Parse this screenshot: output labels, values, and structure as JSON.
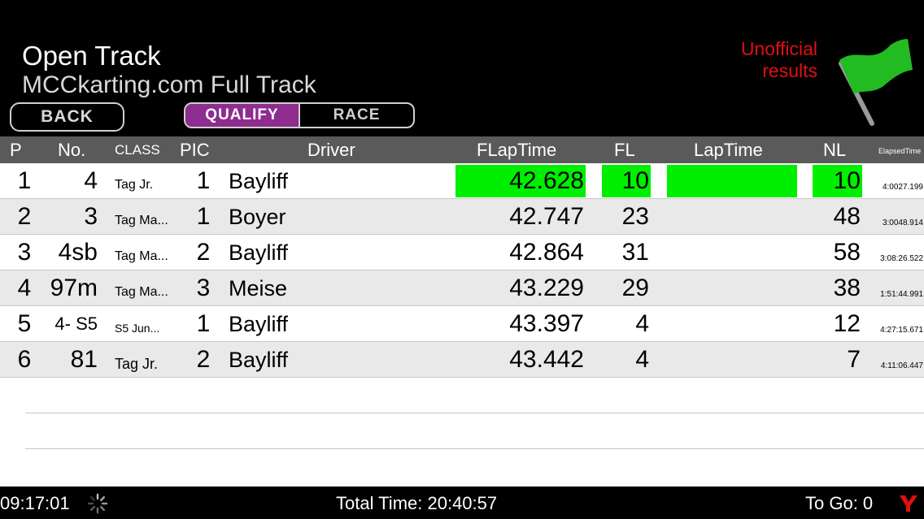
{
  "header": {
    "title": "Open Track",
    "subtitle": "MCCkarting.com Full Track",
    "back_label": "BACK",
    "tabs": [
      {
        "label": "QUALIFY",
        "active": true
      },
      {
        "label": "RACE",
        "active": false
      }
    ],
    "notice_line1": "Unofficial",
    "notice_line2": "results",
    "flag_color": "#22bb22"
  },
  "table": {
    "columns": {
      "p": "P",
      "no": "No.",
      "class": "CLASS",
      "pic": "PIC",
      "driver": "Driver",
      "flaptime": "FLapTime",
      "fl": "FL",
      "laptime": "LapTime",
      "nl": "NL",
      "elapsed": "ElapsedTime"
    },
    "rows": [
      {
        "p": "1",
        "no": "4",
        "class": "Tag Jr.",
        "pic": "1",
        "driver": "Bayliff",
        "flaptime": "42.628",
        "fl": "10",
        "laptime": "",
        "nl": "10",
        "elapsed": "4:0027.199"
      },
      {
        "p": "2",
        "no": "3",
        "class": "Tag Ma...",
        "pic": "1",
        "driver": "Boyer",
        "flaptime": "42.747",
        "fl": "23",
        "laptime": "",
        "nl": "48",
        "elapsed": "3:0048.914"
      },
      {
        "p": "3",
        "no": "4sb",
        "class": "Tag Ma...",
        "pic": "2",
        "driver": "Bayliff",
        "flaptime": "42.864",
        "fl": "31",
        "laptime": "",
        "nl": "58",
        "elapsed": "3:08:26.522"
      },
      {
        "p": "4",
        "no": "97m",
        "class": "Tag Ma...",
        "pic": "3",
        "driver": "Meise",
        "flaptime": "43.229",
        "fl": "29",
        "laptime": "",
        "nl": "38",
        "elapsed": "1:51:44.991"
      },
      {
        "p": "5",
        "no": "4- S5",
        "class": "S5 Jun...",
        "pic": "1",
        "driver": "Bayliff",
        "flaptime": "43.397",
        "fl": "4",
        "laptime": "",
        "nl": "12",
        "elapsed": "4:27:15.671"
      },
      {
        "p": "6",
        "no": "81",
        "class": "Tag Jr.",
        "pic": "2",
        "driver": "Bayliff",
        "flaptime": "43.442",
        "fl": "4",
        "laptime": "",
        "nl": "7",
        "elapsed": "4:11:06.447"
      }
    ],
    "highlight_color": "#00ee00"
  },
  "footer": {
    "clock": "09:17:01",
    "total_time": "Total Time: 20:40:57",
    "to_go": "To Go: 0",
    "logo_icon": "y-logo-icon",
    "logo_color": "#e01010"
  }
}
